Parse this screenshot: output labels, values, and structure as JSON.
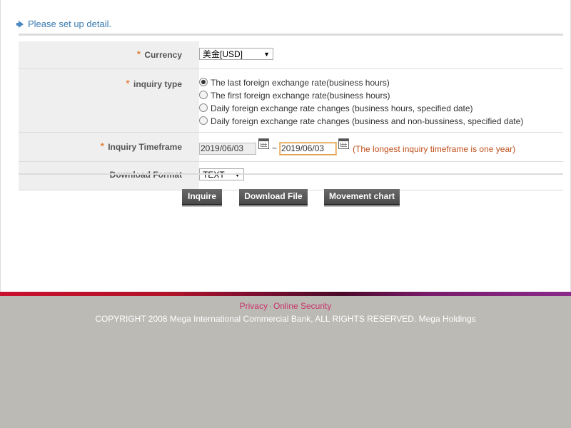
{
  "section_title": "Please set up detail.",
  "form": {
    "currency": {
      "label": "Currency",
      "required": true,
      "value": "美金[USD]"
    },
    "inquiry_type": {
      "label": "inquiry type",
      "required": true,
      "options": [
        "The last foreign exchange rate(business hours)",
        "The first foreign exchange rate(business hours)",
        "Daily foreign exchange rate changes (business hours, specified date)",
        "Daily foreign exchange rate changes (business and non-bussiness, specified date)"
      ],
      "selected_index": 0
    },
    "timeframe": {
      "label": "Inquiry Timeframe",
      "required": true,
      "from": "2019/06/03",
      "separator": "~",
      "to": "2019/06/03",
      "hint": "(The longest inquiry timeframe is one year)"
    },
    "download_format": {
      "label": "Download Format",
      "value": "TEXT"
    },
    "required_mark": "*",
    "caret": "▼"
  },
  "buttons": {
    "inquire": "Inquire",
    "download": "Download File",
    "movement": "Movement chart"
  },
  "footer": {
    "privacy": "Privacy",
    "separator": "·",
    "security": "Online Security",
    "copyright": "COPYRIGHT 2008 Mega International Commercial Bank, ALL RIGHTS RESERVED. Mega Holdings"
  },
  "colors": {
    "accent_blue": "#3a7ab0",
    "required_orange": "#e07020",
    "hint_red": "#c0501c",
    "link_pink": "#c8346a",
    "footer_bg": "#bcbab5",
    "button_bg": "#5a5a5a"
  }
}
